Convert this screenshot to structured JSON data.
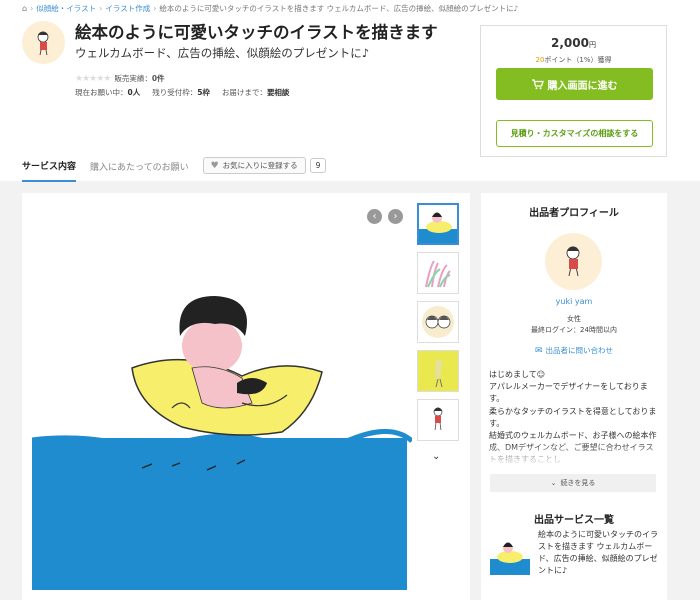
{
  "breadcrumb": {
    "items": [
      "似顔絵・イラスト",
      "イラスト作成",
      "絵本のように可愛いタッチのイラストを描きます ウェルカムボード、広告の挿絵、似顔絵のプレゼントに♪"
    ]
  },
  "header": {
    "title": "絵本のように可愛いタッチのイラストを描きます",
    "subtitle": "ウェルカムボード、広告の挿絵、似顔絵のプレゼントに♪",
    "sales_label": "販売実績：",
    "sales_value": "0件",
    "current_requests_label": "現在お願い中：",
    "current_requests_value": "0人",
    "slots_label": "残り受付枠：",
    "slots_value": "5枠",
    "delivery_label": "お届けまで：",
    "delivery_value": "要相談"
  },
  "purchase": {
    "price": "2,000",
    "currency": "円",
    "points_num": "20",
    "points_text": "ポイント（1%）獲得",
    "buy_label": "購入画面に進む",
    "consult_label": "見積り・カスタマイズの相談をする"
  },
  "tabs": {
    "service": "サービス内容",
    "notes": "購入にあたってのお願い",
    "favorite": "お気に入りに登録する",
    "favorite_count": "9"
  },
  "profile": {
    "heading": "出品者プロフィール",
    "name": "yuki yam",
    "gender": "女性",
    "last_login": "最終ログイン：24時間以内",
    "contact": "出品者に問い合わせ",
    "bio": [
      "はじめまして☺",
      "アパレルメーカーでデザイナーをしております。",
      "柔らかなタッチのイラストを得意としております。",
      "結婚式のウェルカムボード、お子様への絵本作成、DMデザインなど、ご要望に合わせイラストを描きすることし"
    ],
    "more_label": "続きを見る"
  },
  "services": {
    "heading": "出品サービス一覧",
    "item_text": "絵本のように可愛いタッチのイラストを描きます ウェルカムボード、広告の挿絵、似顔絵のプレゼントに♪"
  },
  "colors": {
    "accent_blue": "#3a8ed6",
    "buy_green": "#84bd22",
    "sea_blue": "#1f8cd0",
    "float_yellow": "#f7ee6b"
  }
}
